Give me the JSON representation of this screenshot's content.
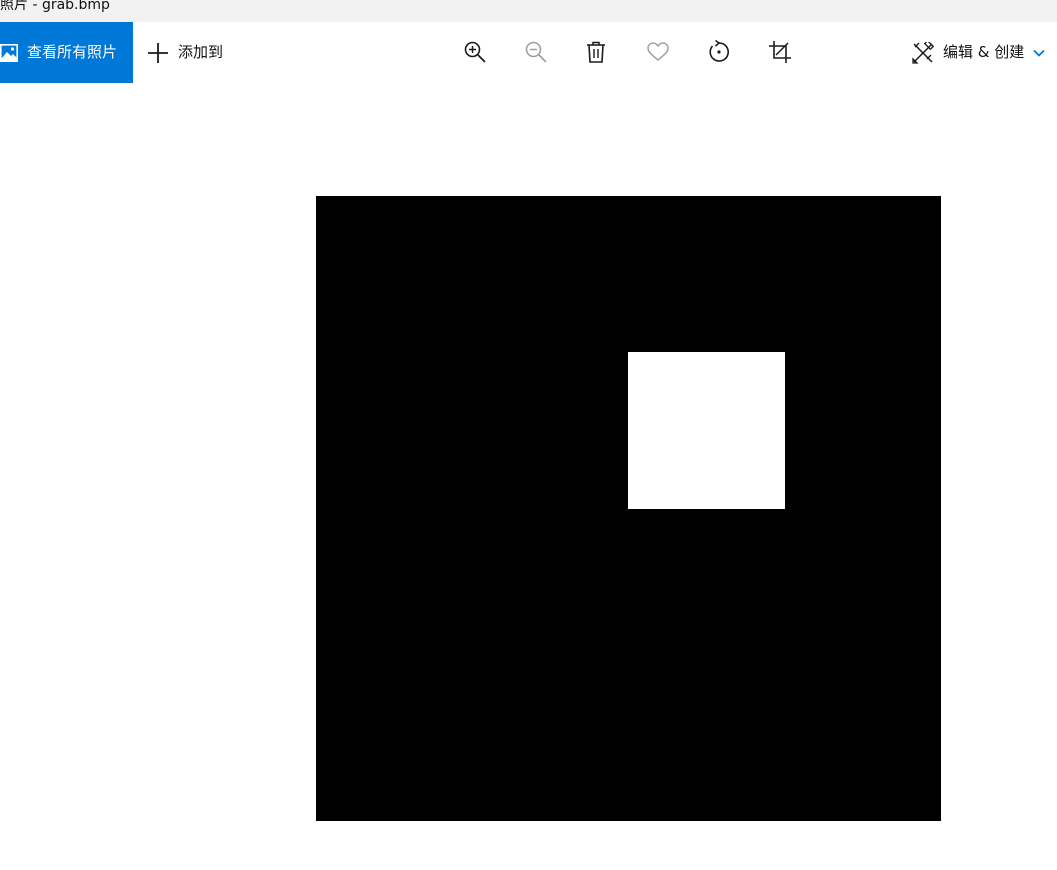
{
  "window": {
    "title": "照片 - grab.bmp"
  },
  "toolbar": {
    "view_all_label": "查看所有照片",
    "add_to_label": "添加到",
    "edit_create_label": "编辑 & 创建",
    "tools": [
      {
        "name": "zoom-in",
        "icon": "zoom-in-icon",
        "enabled": true
      },
      {
        "name": "zoom-out",
        "icon": "zoom-out-icon",
        "enabled": false
      },
      {
        "name": "delete",
        "icon": "trash-icon",
        "enabled": true
      },
      {
        "name": "favorite",
        "icon": "heart-icon",
        "enabled": false
      },
      {
        "name": "rotate",
        "icon": "rotate-icon",
        "enabled": true
      },
      {
        "name": "crop",
        "icon": "crop-icon",
        "enabled": true
      }
    ]
  },
  "image": {
    "file": "grab.bmp",
    "background_color": "#000000",
    "shape_color": "#ffffff"
  },
  "colors": {
    "accent": "#0078d7",
    "icon": "#1a1a1a",
    "icon_disabled": "#a0a0a0"
  }
}
